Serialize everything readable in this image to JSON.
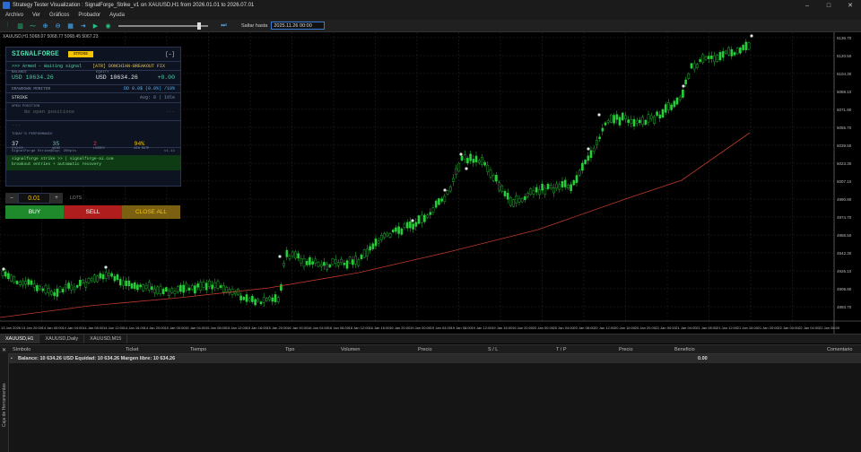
{
  "window": {
    "title": "Strategy Tester Visualization : SignalForge_Strike_v1 on XAUUSD,H1 from 2026.01.01 to 2026.07.01",
    "controls": [
      "–",
      "□",
      "✕"
    ]
  },
  "menu": [
    "Archivo",
    "Ver",
    "Gráficos",
    "Probador",
    "Ayuda"
  ],
  "toolbar": {
    "saltar_label": "Saltar hasta",
    "date_value": "2025.11.26 00:00"
  },
  "chart": {
    "info": "XAUUSD,H1  5068.07 5068.77 5068.45 5067.23",
    "price_labels": [
      "5136.70",
      "5120.50",
      "5104.30",
      "5088.10",
      "5071.90",
      "5055.70",
      "5039.50",
      "5023.30",
      "5007.10",
      "4990.90",
      "4974.70",
      "4958.50",
      "4942.30",
      "4926.10",
      "4909.90",
      "4893.70"
    ],
    "time_labels": [
      "13 Jan 2026",
      "13 Jan 20:00",
      "14 Jan 00:00",
      "14 Jan 04:00",
      "14 Jan 08:00",
      "14 Jan 12:00",
      "14 Jan 16:00",
      "14 Jan 20:00",
      "15 Jan 00:00",
      "15 Jan 04:00",
      "15 Jan 08:00",
      "15 Jan 12:00",
      "15 Jan 16:00",
      "15 Jan 20:00",
      "16 Jan 00:00",
      "16 Jan 04:00",
      "16 Jan 08:00",
      "16 Jan 12:00",
      "16 Jan 16:00",
      "16 Jan 20:00",
      "19 Jan 00:00",
      "19 Jan 04:00",
      "19 Jan 08:00",
      "19 Jan 12:00",
      "19 Jan 16:00",
      "19 Jan 20:00",
      "20 Jan 00:00",
      "20 Jan 04:00",
      "20 Jan 08:00",
      "20 Jan 12:00",
      "20 Jan 16:00",
      "20 Jan 20:00",
      "21 Jan 00:00",
      "21 Jan 04:00",
      "21 Jan 08:00",
      "21 Jan 12:00",
      "21 Jan 16:00",
      "21 Jan 20:00",
      "22 Jan 00:00",
      "22 Jan 04:00",
      "22 Jan 08:00"
    ],
    "colors": {
      "bull": "#26d03a",
      "bear": "#26d03a",
      "ma": "#c0392b",
      "grid": "#2a2a2a"
    }
  },
  "panel": {
    "brand": "SIGNALFORGE",
    "tag": "STRIKE",
    "collapse": "[–]",
    "status": ">>> Armed - Waiting signal",
    "mode": "[ATR] DONCHIAN-BREAKOUT FIX",
    "balance_label": "BALANCE",
    "balance_value": "USD 10634.26",
    "equity_label": "EQUITY",
    "equity_value": "USD 10634.26",
    "equity_delta": "+0.00",
    "drawdown_label": "DRAWDOWN MONITOR",
    "drawdown_value": "DD 0.0$ (0.0%) /10%",
    "strike_label": "STRIKE",
    "strike_status": "Avg: 0 | Idle",
    "open_label": "OPEN POSITION",
    "open_none": "No open positions",
    "open_dashes": "---",
    "open_right": "---",
    "perf_label": "TODAY'S PERFORMANCE",
    "perf": [
      {
        "num": "37",
        "lbl": "CYCLES",
        "color": "#e8e8e8"
      },
      {
        "num": "35",
        "lbl": "WINS",
        "color": "#4dd0a6"
      },
      {
        "num": "2",
        "lbl": "LOSSES",
        "color": "#e04040"
      },
      {
        "num": "94%",
        "lbl": "WIN RATE",
        "color": "#f5c400"
      }
    ],
    "sig_left": "SignalForge Strike@Cup: 200pts",
    "sig_right": "v1.11",
    "promo_1": "signalforge strike >> | signalforge-ai.com",
    "promo_2": "breakout entries + automatic recovery"
  },
  "trade": {
    "minus": "–",
    "lot": "0.01",
    "plus": "+",
    "lot_label": "LOTS",
    "buy": "BUY",
    "sell": "SELL",
    "close_all": "CLOSE ALL"
  },
  "tabs": [
    "XAUUSD,H1",
    "XAUUSD,Daily",
    "XAUUSD,M15"
  ],
  "terminal": {
    "columns": [
      "Símbolo",
      "Ticket",
      "Tiempo",
      "Tipo",
      "Volumen",
      "Precio",
      "S / L",
      "T / P",
      "Precio",
      "Beneficio",
      "Comentario"
    ],
    "balance_row": "Balance: 10 634.26 USD  Equidad: 10 634.26  Margen libre: 10 634.26",
    "profit": "0.00",
    "side_label": "Caja de Herramientas"
  }
}
